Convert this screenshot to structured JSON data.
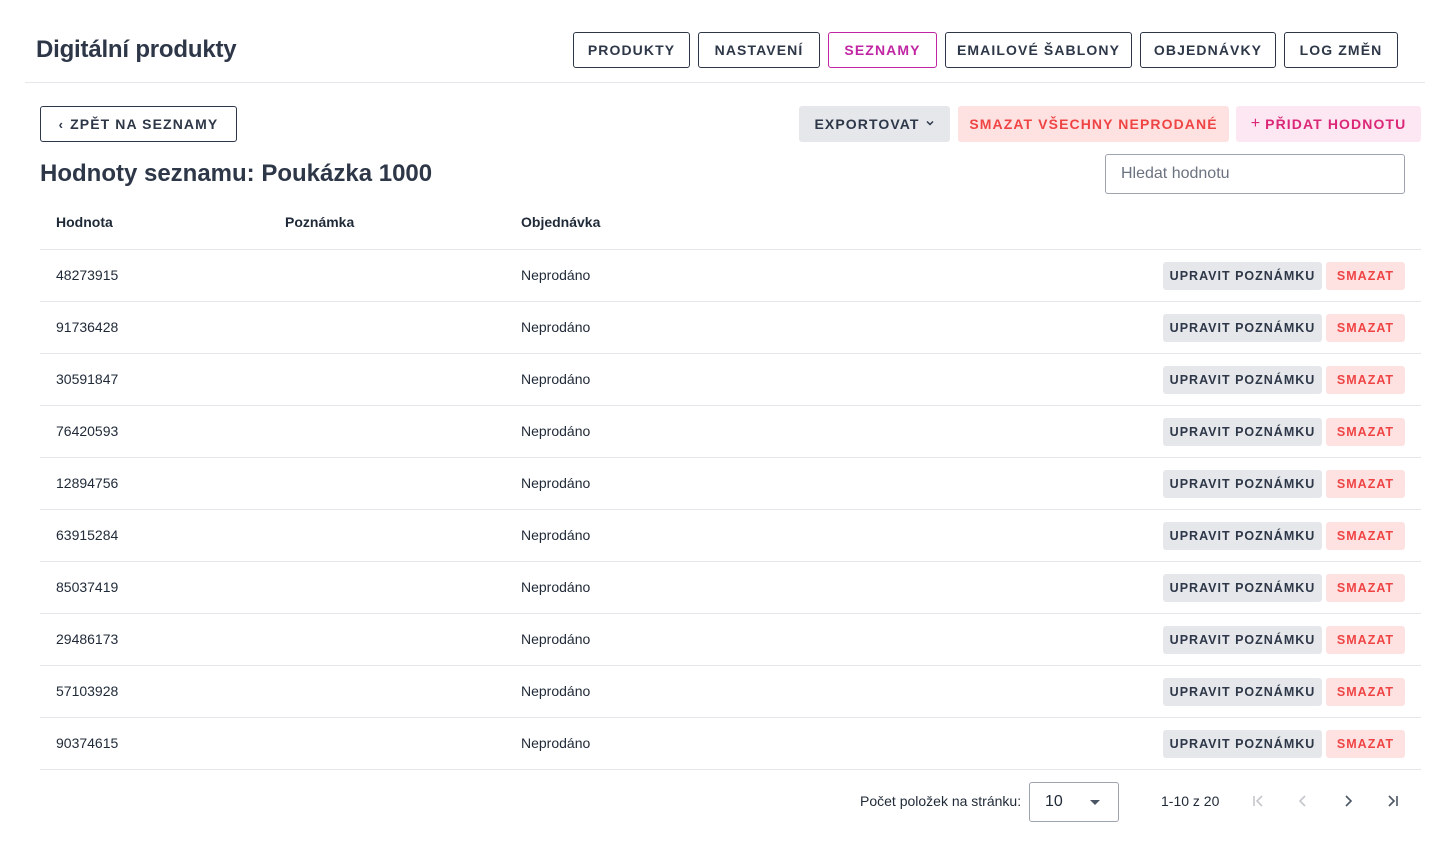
{
  "header": {
    "title": "Digitální produkty",
    "nav": [
      {
        "label": "PRODUKTY",
        "active": false
      },
      {
        "label": "NASTAVENÍ",
        "active": false
      },
      {
        "label": "SEZNAMY",
        "active": true
      },
      {
        "label": "EMAILOVÉ ŠABLONY",
        "active": false
      },
      {
        "label": "OBJEDNÁVKY",
        "active": false
      },
      {
        "label": "LOG ZMĚN",
        "active": false
      }
    ]
  },
  "toolbar": {
    "back_label": "ZPĚT NA SEZNAMY",
    "export_label": "EXPORTOVAT",
    "delete_all_label": "SMAZAT VŠECHNY NEPRODANÉ",
    "add_label": "PŘIDAT HODNOTU"
  },
  "page": {
    "title": "Hodnoty seznamu: Poukázka 1000",
    "search_placeholder": "Hledat hodnotu"
  },
  "table": {
    "columns": [
      "Hodnota",
      "Poznámka",
      "Objednávka"
    ],
    "edit_label": "UPRAVIT POZNÁMKU",
    "delete_label": "SMAZAT",
    "rows": [
      {
        "value": "48273915",
        "note": "",
        "order": "Neprodáno"
      },
      {
        "value": "91736428",
        "note": "",
        "order": "Neprodáno"
      },
      {
        "value": "30591847",
        "note": "",
        "order": "Neprodáno"
      },
      {
        "value": "76420593",
        "note": "",
        "order": "Neprodáno"
      },
      {
        "value": "12894756",
        "note": "",
        "order": "Neprodáno"
      },
      {
        "value": "63915284",
        "note": "",
        "order": "Neprodáno"
      },
      {
        "value": "85037419",
        "note": "",
        "order": "Neprodáno"
      },
      {
        "value": "29486173",
        "note": "",
        "order": "Neprodáno"
      },
      {
        "value": "57103928",
        "note": "",
        "order": "Neprodáno"
      },
      {
        "value": "90374615",
        "note": "",
        "order": "Neprodáno"
      }
    ]
  },
  "pagination": {
    "per_page_label": "Počet položek na stránku:",
    "per_page_value": "10",
    "range": "1-10 z 20"
  },
  "colors": {
    "accent": "#c026a3",
    "danger": "#ef4444",
    "danger_bg": "#fee2e2",
    "add_bg": "#fce7f3",
    "text": "#2d3748"
  }
}
